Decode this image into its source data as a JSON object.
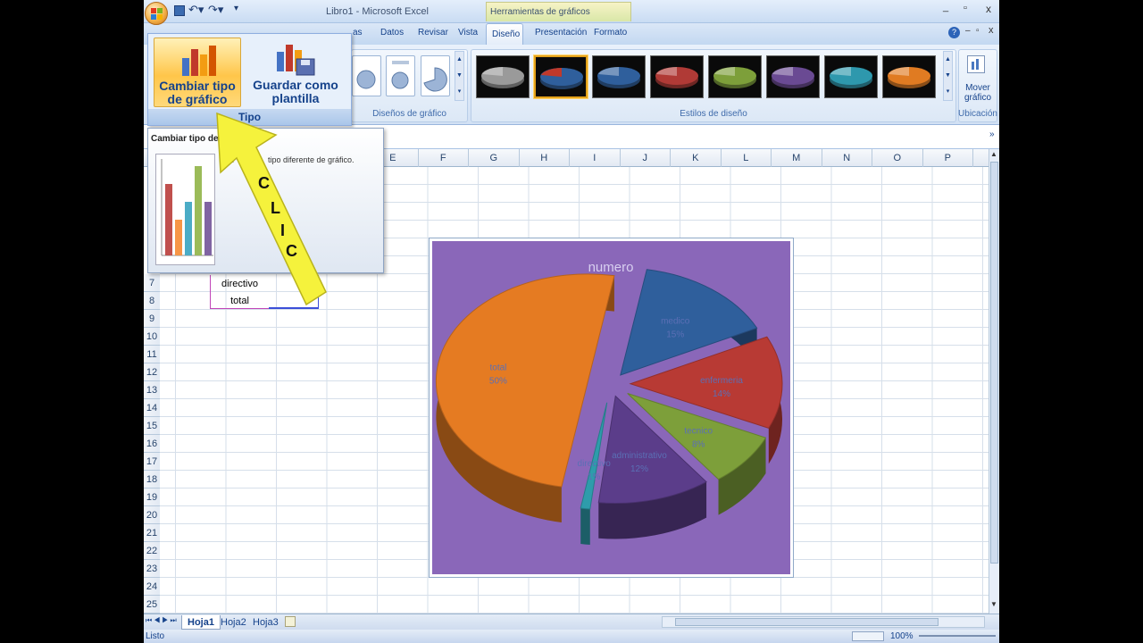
{
  "window": {
    "title": "Libro1 - Microsoft Excel",
    "context_tab": "Herramientas de gráficos",
    "controls": [
      "_",
      "▫",
      "x"
    ]
  },
  "tabs": [
    {
      "label": "Datos"
    },
    {
      "label": "Revisar"
    },
    {
      "label": "Vista"
    },
    {
      "label": "Diseño"
    },
    {
      "label": "Presentación"
    },
    {
      "label": "Formato"
    }
  ],
  "partial_tab": "as",
  "ribbon": {
    "tipo_group": {
      "label": "Tipo",
      "change_type": "Cambiar tipo\nde gráfico",
      "save_template": "Guardar como\nplantilla"
    },
    "layouts_label": "Diseños de gráfico",
    "styles_label": "Estilos de diseño",
    "location_label": "Ubicación",
    "move_chart": "Mover\ngráfico",
    "style_colors": [
      "#9a9a9a",
      "#2f5f9c",
      "#2f5f9c",
      "#b03a36",
      "#7d9f3a",
      "#6a4a93",
      "#2e98ad",
      "#e07b22"
    ]
  },
  "tooltip": {
    "title": "Cambiar tipo de gráfico",
    "description": "Cambiar a un tipo diferente de gráfico.",
    "visible_title": "Cambiar tipo de gr",
    "visible_desc_a": "Ca",
    "visible_desc_b": "tipo diferente de gráfico."
  },
  "annotation": {
    "text": "C L I C",
    "color": "#f3f03a"
  },
  "columns": [
    "E",
    "F",
    "G",
    "H",
    "I",
    "J",
    "K",
    "L",
    "M",
    "N",
    "O",
    "P"
  ],
  "rows": [
    "7",
    "8",
    "9",
    "10",
    "11",
    "12",
    "13",
    "14",
    "15",
    "16",
    "17",
    "18",
    "19",
    "20",
    "21",
    "22",
    "23",
    "24",
    "25"
  ],
  "cells": {
    "b7": "directivo",
    "b8": "total"
  },
  "sheets": [
    "Hoja1",
    "Hoja2",
    "Hoja3"
  ],
  "status": {
    "left": "Listo",
    "zoom": "100%"
  },
  "chart_data": {
    "type": "pie",
    "title": "numero",
    "style": "3d-exploded",
    "background": "#8a67b9",
    "slices": [
      {
        "label": "medico",
        "pct_label": "15%",
        "value": 15,
        "color": "#2f5f9c"
      },
      {
        "label": "enfermeria",
        "pct_label": "14%",
        "value": 14,
        "color": "#b83a34"
      },
      {
        "label": "tecnico",
        "pct_label": "8%",
        "value": 8,
        "color": "#7d9f3a"
      },
      {
        "label": "administrativo",
        "pct_label": "12%",
        "value": 12,
        "color": "#5b3d8a"
      },
      {
        "label": "directivo",
        "pct_label": "1%",
        "value": 1,
        "color": "#2e9cab"
      },
      {
        "label": "total",
        "pct_label": "50%",
        "value": 50,
        "color": "#e57b22"
      }
    ]
  }
}
